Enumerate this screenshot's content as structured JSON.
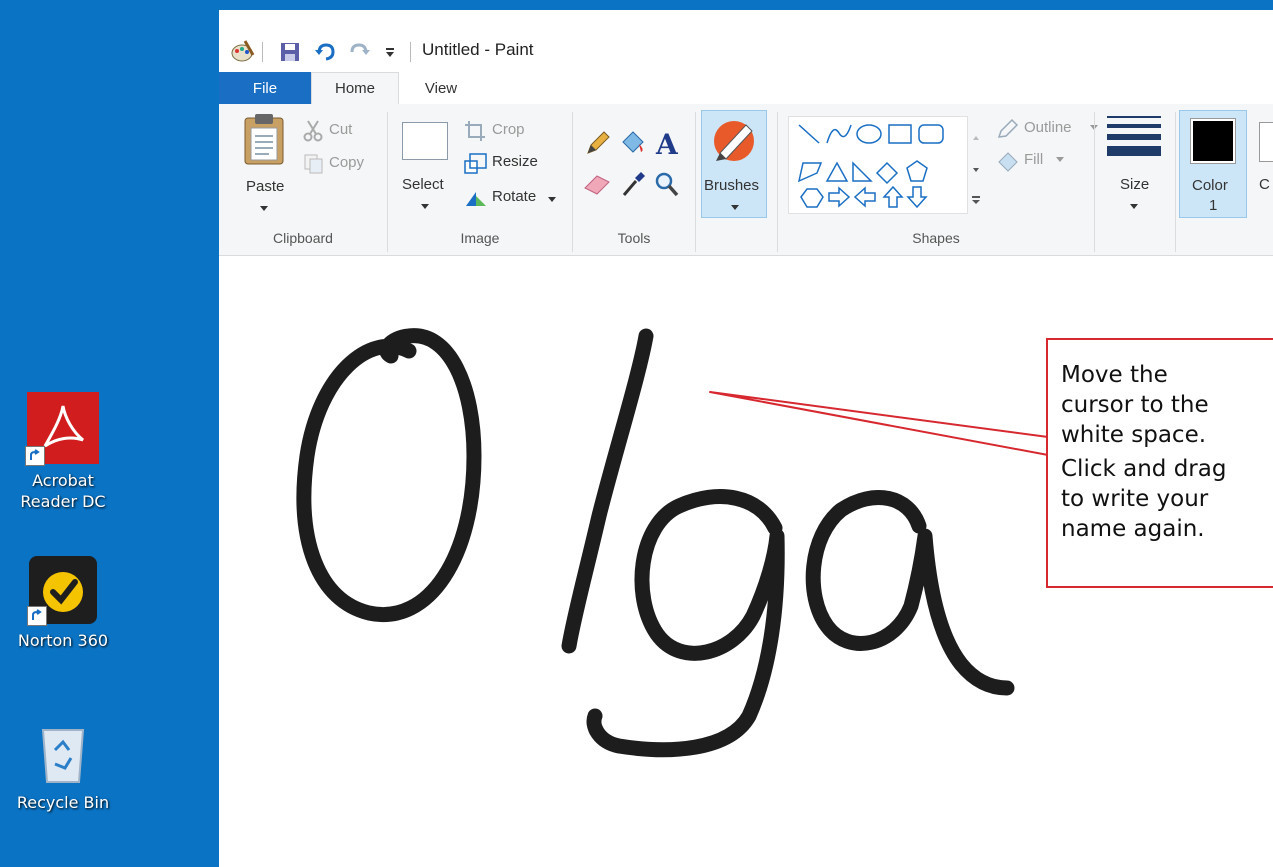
{
  "desktop": {
    "icons": [
      {
        "label_line1": "Acrobat",
        "label_line2": "Reader DC"
      },
      {
        "label_line1": "Norton 360"
      },
      {
        "label_line1": "Recycle Bin"
      }
    ]
  },
  "window": {
    "title": "Untitled - Paint"
  },
  "tabs": [
    "File",
    "Home",
    "View"
  ],
  "ribbon": {
    "clipboard": {
      "paste": "Paste",
      "cut": "Cut",
      "copy": "Copy",
      "label": "Clipboard"
    },
    "image": {
      "select": "Select",
      "crop": "Crop",
      "resize": "Resize",
      "rotate": "Rotate",
      "label": "Image"
    },
    "tools": {
      "label": "Tools"
    },
    "brushes": {
      "label": "Brushes"
    },
    "shapes": {
      "outline": "Outline",
      "fill": "Fill",
      "label": "Shapes"
    },
    "size": {
      "label": "Size"
    },
    "color1": {
      "label_line1": "Color",
      "label_line2": "1"
    },
    "color2": {
      "partial": "C"
    }
  },
  "canvas": {
    "handwriting": "Olga"
  },
  "callout": {
    "p1": [
      "Move the",
      "cursor to the",
      "white space."
    ],
    "p2": [
      "Click and drag",
      "to write your",
      "name again."
    ]
  },
  "colors": {
    "desktop_blue": "#0a73c4",
    "file_tab_blue": "#1a6fc4",
    "callout_red": "#d7282f",
    "ink": "#111111",
    "selected_tool": "#cde6f7"
  }
}
